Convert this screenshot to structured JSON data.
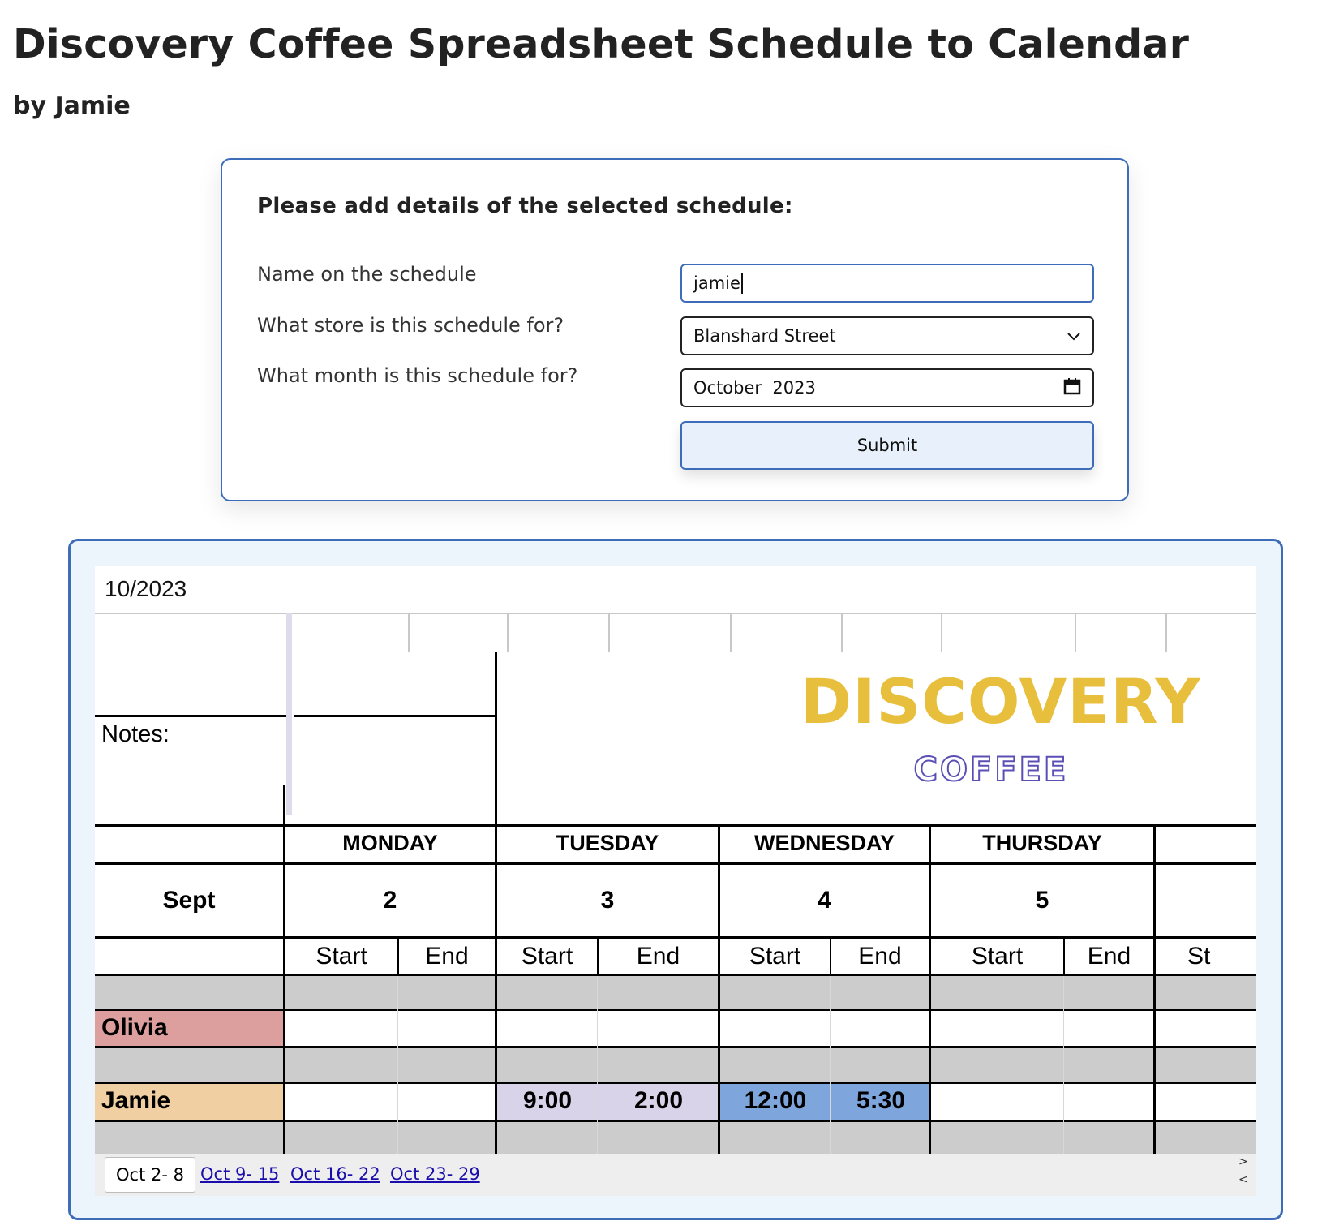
{
  "header": {
    "title": "Discovery Coffee Spreadsheet Schedule to Calendar",
    "author": "by Jamie"
  },
  "form": {
    "heading": "Please add details of the selected schedule:",
    "name_label": "Name on the schedule",
    "name_value": "jamie",
    "store_label": "What store is this schedule for?",
    "store_value": "Blanshard Street",
    "month_label": "What month is this schedule for?",
    "month_value": "October  2023",
    "submit_label": "Submit"
  },
  "sheet": {
    "date": "10/2023",
    "notes_label": "Notes:",
    "logo": {
      "line1": "DISCOVERY",
      "line2": "COFFEE",
      "line1_color": "#e8bf3c",
      "line2_color": "#5b4fb5"
    },
    "month_label": "Sept",
    "days": [
      {
        "name": "MONDAY",
        "date": "2",
        "start": "Start",
        "end": "End"
      },
      {
        "name": "TUESDAY",
        "date": "3",
        "start": "Start",
        "end": "End"
      },
      {
        "name": "WEDNESDAY",
        "date": "4",
        "start": "Start",
        "end": "End"
      },
      {
        "name": "THURSDAY",
        "date": "5",
        "start": "Start",
        "end": "End"
      }
    ],
    "partial_start": "St",
    "employees": [
      {
        "name": "Olivia",
        "color": "#dd9e9e"
      },
      {
        "name": "Jamie",
        "color": "#f0cfa2"
      }
    ],
    "shifts": {
      "tuesday": {
        "start": "9:00",
        "end": "2:00",
        "color": "#d9d3ea"
      },
      "wednesday": {
        "start": "12:00",
        "end": "5:30",
        "color": "#7fa6dc"
      }
    },
    "row_fill_color": "#cccccc",
    "tabs": [
      "Oct 2- 8",
      "Oct 9- 15",
      "Oct 16- 22",
      "Oct 23- 29"
    ],
    "scroll_right": ">",
    "scroll_left": "<"
  }
}
